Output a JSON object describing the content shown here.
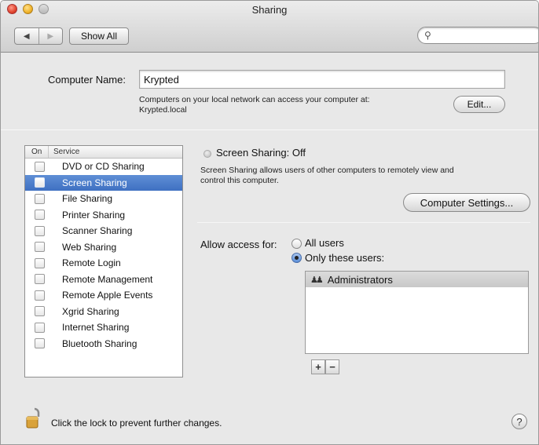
{
  "window": {
    "title": "Sharing"
  },
  "toolbar": {
    "back_glyph": "◀",
    "forward_glyph": "▶",
    "show_all_label": "Show All",
    "search_placeholder": "",
    "search_icon": "magnifier-icon"
  },
  "computer_name": {
    "label": "Computer Name:",
    "value": "Krypted",
    "description_line1": "Computers on your local network can access your computer at:",
    "description_line2": "Krypted.local",
    "edit_label": "Edit..."
  },
  "services": {
    "header_on": "On",
    "header_service": "Service",
    "items": [
      {
        "label": "DVD or CD Sharing",
        "checked": false,
        "selected": false
      },
      {
        "label": "Screen Sharing",
        "checked": false,
        "selected": true
      },
      {
        "label": "File Sharing",
        "checked": false,
        "selected": false
      },
      {
        "label": "Printer Sharing",
        "checked": false,
        "selected": false
      },
      {
        "label": "Scanner Sharing",
        "checked": false,
        "selected": false
      },
      {
        "label": "Web Sharing",
        "checked": false,
        "selected": false
      },
      {
        "label": "Remote Login",
        "checked": false,
        "selected": false
      },
      {
        "label": "Remote Management",
        "checked": false,
        "selected": false
      },
      {
        "label": "Remote Apple Events",
        "checked": false,
        "selected": false
      },
      {
        "label": "Xgrid Sharing",
        "checked": false,
        "selected": false
      },
      {
        "label": "Internet Sharing",
        "checked": false,
        "selected": false
      },
      {
        "label": "Bluetooth Sharing",
        "checked": false,
        "selected": false
      }
    ]
  },
  "detail": {
    "status_title": "Screen Sharing: Off",
    "status_desc_line1": "Screen Sharing allows users of other computers to remotely view and",
    "status_desc_line2": "control this computer.",
    "computer_settings_label": "Computer Settings...",
    "access_label": "Allow access for:",
    "option_all": "All users",
    "option_only": "Only these users:",
    "selected_option": "only",
    "users": [
      {
        "name": "Administrators",
        "icon": "group-icon"
      }
    ],
    "add_label": "+",
    "remove_label": "−"
  },
  "footer": {
    "lock_text": "Click the lock to prevent further changes.",
    "help_label": "?"
  },
  "colors": {
    "selection": "#3f70c2",
    "window_bg": "#e8e8e8"
  }
}
